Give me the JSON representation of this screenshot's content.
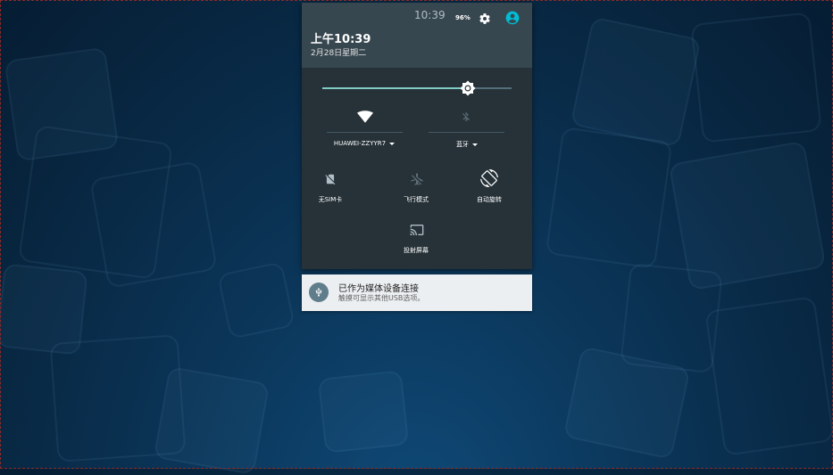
{
  "status_bar": {
    "time": "10:39",
    "battery": "96%",
    "settings_icon": "gear-icon",
    "user_icon": "account-circle-icon"
  },
  "header": {
    "time": "上午10:39",
    "date": "2月28日星期二"
  },
  "brightness": {
    "level": 0.77,
    "icon": "brightness-icon"
  },
  "quick_settings": {
    "wifi": {
      "label": "HUAWEI-ZZYYR7",
      "icon": "wifi-icon",
      "active": true
    },
    "bluetooth": {
      "label": "蓝牙",
      "icon": "bluetooth-off-icon",
      "active": false
    },
    "sim": {
      "label": "无SIM卡",
      "icon": "no-sim-icon"
    },
    "airplane": {
      "label": "飞行模式",
      "icon": "airplane-icon"
    },
    "rotate": {
      "label": "自动旋转",
      "icon": "rotate-icon"
    },
    "cast": {
      "label": "投射屏幕",
      "icon": "cast-icon"
    }
  },
  "notification": {
    "title": "已作为媒体设备连接",
    "text": "触摸可显示其他USB选项。",
    "icon": "usb-icon"
  },
  "colors": {
    "shade_bg": "#263238",
    "header_bg": "#37474f",
    "accent": "#80cbc4",
    "user_icon": "#00bcd4"
  }
}
